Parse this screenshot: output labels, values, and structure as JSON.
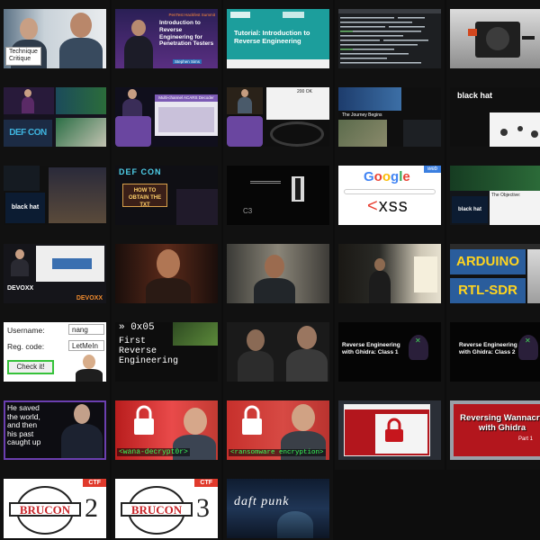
{
  "colors": {
    "background": "#0d0d0d",
    "focus_border": "#6b3fb0",
    "ctf_red": "#e03a2c",
    "checkit_green": "#36c23a",
    "web_tag_blue": "#3b7fe0"
  },
  "videos": [
    {
      "name": "technique-critique",
      "texts": {
        "badge_line1": "Technique",
        "badge_line2": "Critique"
      }
    },
    {
      "name": "intro-reverse-engineering-pentesters",
      "texts": {
        "event": "PenTest Hackfest Summit",
        "title": "Introduction to Reverse Engineering for Penetration Testers",
        "speaker": "Stephen Sims"
      }
    },
    {
      "name": "tutorial-intro-reverse-engineering",
      "texts": {
        "title": "Tutorial: Introduction to Reverse Engineering"
      }
    },
    {
      "name": "terminal-session",
      "texts": {}
    },
    {
      "name": "hardware-board-closeup",
      "texts": {}
    },
    {
      "name": "defcon-talk",
      "texts": {
        "logo": "DEF CON"
      }
    },
    {
      "name": "multichannel-acars-decoder",
      "texts": {
        "slide_title": "Multi-channel ACARS Decoder"
      }
    },
    {
      "name": "stage-talk-200-ok",
      "texts": {
        "slide_label": "200 OK"
      }
    },
    {
      "name": "blackhat-journey-begins",
      "texts": {
        "logo": "black hat",
        "slide": "The Journey Begins"
      }
    },
    {
      "name": "blackhat-malware-talk",
      "texts": {
        "logo": "black hat"
      }
    },
    {
      "name": "blackhat-firmware-talk",
      "texts": {
        "logo": "black hat"
      }
    },
    {
      "name": "defcon-how-to-obtain",
      "texts": {
        "title": "HOW TO OBTAIN THE TXT"
      }
    },
    {
      "name": "c3-dark-slide",
      "texts": {
        "label": "C3"
      }
    },
    {
      "name": "google-xss",
      "texts": {
        "tag": "web",
        "logo": "Google",
        "big": "<xss"
      }
    },
    {
      "name": "blackhat-the-objective",
      "texts": {
        "logo": "black hat",
        "slide": "The Objective:"
      }
    },
    {
      "name": "devoxx-talk",
      "texts": {
        "logo": "DEVOXX"
      }
    },
    {
      "name": "man-closeup-red",
      "texts": {}
    },
    {
      "name": "man-talking-room",
      "texts": {}
    },
    {
      "name": "speaker-presenting-screen",
      "texts": {}
    },
    {
      "name": "arduino-rtl-sdr",
      "texts": {
        "line1": "ARDUINO",
        "line2": "RTL-SDR"
      }
    },
    {
      "name": "crackme-username",
      "texts": {
        "user_label": "Username:",
        "user_value": "nang",
        "code_label": "Reg. code:",
        "code_value": "LetMeIn",
        "button": "Check it!"
      }
    },
    {
      "name": "first-reverse-engineering",
      "texts": {
        "number": "» 0x05",
        "line1": "First",
        "line2": "Reverse",
        "line3": "Engineering"
      }
    },
    {
      "name": "two-men-talking",
      "texts": {}
    },
    {
      "name": "ghidra-class-1",
      "texts": {
        "title": "Reverse Engineering with Ghidra: Class 1"
      }
    },
    {
      "name": "ghidra-class-2",
      "texts": {
        "title": "Reverse Engineering with Ghidra: Class 2"
      }
    },
    {
      "name": "saved-the-world",
      "texts": {
        "line1": "He saved",
        "line2": "the world,",
        "line3": "and then",
        "line4": "his past",
        "line5": "caught up"
      }
    },
    {
      "name": "wana-decryptor",
      "texts": {
        "caption": "<wana-decrypt0r>"
      }
    },
    {
      "name": "ransomware-encryption",
      "texts": {
        "caption": "<ransomware encryption>"
      }
    },
    {
      "name": "wannacry-window",
      "texts": {}
    },
    {
      "name": "reversing-wannacry-ghidra",
      "texts": {
        "line1": "Reversing Wannacry",
        "line2": "with Ghidra",
        "part": "Part 1"
      }
    },
    {
      "name": "brucon-ctf-2",
      "texts": {
        "ctf": "CTF",
        "logo": "BRUCON",
        "number": "2"
      }
    },
    {
      "name": "brucon-ctf-3",
      "texts": {
        "ctf": "CTF",
        "logo": "BRUCON",
        "number": "3"
      }
    },
    {
      "name": "daft-punk",
      "texts": {
        "logo": "daft punk"
      }
    }
  ]
}
